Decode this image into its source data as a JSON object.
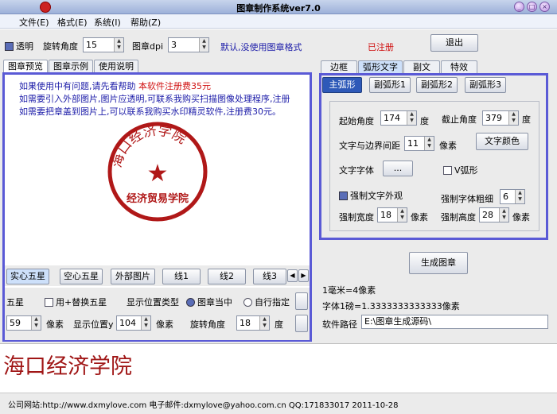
{
  "window": {
    "title": "图章制作系统ver7.0",
    "controls": [
      "_",
      "□",
      "×"
    ]
  },
  "menu": [
    "文件(E)",
    "格式(E)",
    "系统(I)",
    "帮助(Z)"
  ],
  "toolbar": {
    "transparent_label": "透明",
    "rotate_label": "旋转角度",
    "rotate_value": "15",
    "dpi_label": "图章dpi",
    "dpi_value": "3",
    "default_note": "默认,没使用图章格式",
    "registered": "已注册",
    "exit_label": "退出"
  },
  "left_tabs": [
    "图章预览",
    "图章示例",
    "使用说明"
  ],
  "info_lines": [
    "如果使用中有问题,请先看帮助",
    "本软件注册费35元",
    "如需要引入外部图片,图片应透明,可联系我购买扫描图像处理程序,注册",
    "如需要把章盖到图片上,可以联系我购买水印精灵软件,注册费30元。"
  ],
  "stamp": {
    "top_text": "海口经济学院",
    "bottom_text": "经济贸易学院",
    "star": "★",
    "color": "#b01818"
  },
  "shape_buttons": [
    "实心五星",
    "空心五星",
    "外部图片",
    "线1",
    "线2",
    "线3"
  ],
  "scroll_arrows": [
    "◀",
    "▶"
  ],
  "options": {
    "five_star": "五星",
    "replace_star": "用+替换五星",
    "pos_type_label": "显示位置类型",
    "center_label": "图章当中",
    "custom_label": "自行指定"
  },
  "bottom_row": {
    "value1": "59",
    "unit1": "像素",
    "pos_y_label": "显示位置y",
    "pos_y_value": "104",
    "unit2": "像素",
    "rotate_label": "旋转角度",
    "rotate_value": "18",
    "unit3": "度"
  },
  "right_tabs": [
    "边框",
    "弧形文字",
    "副文",
    "特效"
  ],
  "arc_tabs": [
    "主弧形",
    "副弧形1",
    "副弧形2",
    "副弧形3"
  ],
  "arc": {
    "start_label": "起始角度",
    "start_value": "174",
    "deg": "度",
    "end_label": "截止角度",
    "end_value": "379",
    "margin_label": "文字与边界间距",
    "margin_value": "11",
    "px": "像素",
    "text_color_btn": "文字颜色",
    "font_label": "文字字体",
    "font_btn": "...",
    "v_arc_label": "V弧形",
    "force_look_label": "强制文字外观",
    "force_bold_label": "强制字体粗细",
    "force_bold_value": "6",
    "force_width_label": "强制宽度",
    "force_width_value": "18",
    "force_height_label": "强制高度",
    "force_height_value": "28"
  },
  "generate_label": "生成图章",
  "info": {
    "mm": "1毫米=4像素",
    "char": "字体1磅=1.3333333333333像素",
    "path_label": "软件路径",
    "path_value": "E:\\图章生成源码\\"
  },
  "text_area": "海口经济学院",
  "status": "公司网站:http://www.dxmylove.com 电子邮件:dxmylove@yahoo.com.cn QQ:171833017  2011-10-28"
}
